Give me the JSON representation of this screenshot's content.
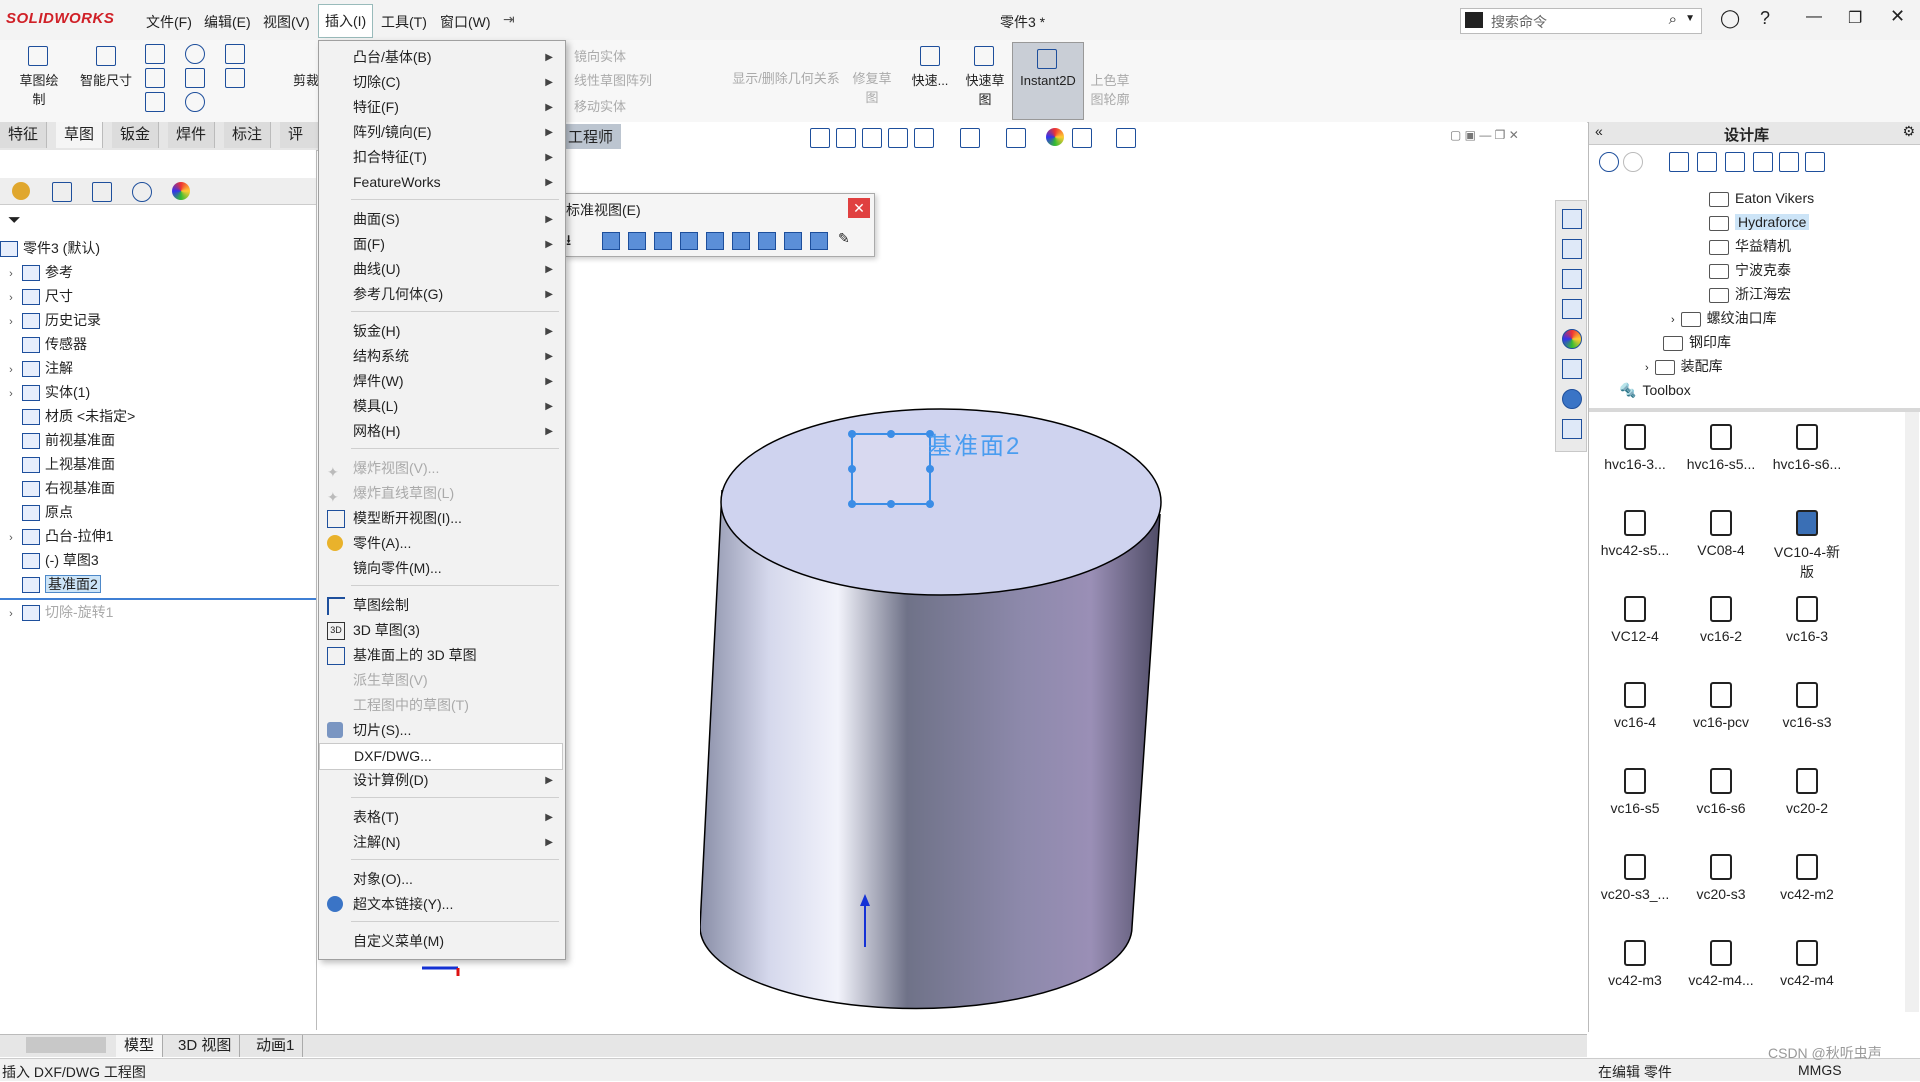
{
  "app": {
    "logo_text": "SOLIDWORKS",
    "doc_title": "零件3 *"
  },
  "menubar": [
    "文件(F)",
    "编辑(E)",
    "视图(V)",
    "插入(I)",
    "工具(T)",
    "窗口(W)"
  ],
  "search": {
    "placeholder": "搜索命令"
  },
  "commands": {
    "sketch": "草图绘制",
    "smart_dim": "智能尺寸",
    "cut": "剪裁",
    "mirror_entity": "镜向实体",
    "linear_pattern": "线性草图阵列",
    "move_entity": "移动实体",
    "show_delete": "显示/删除几何关系",
    "repair": "修复草图",
    "quick_snap": "快速...",
    "rapid_sketch": "快速草图",
    "instant2d": "Instant2D",
    "shaded_contour": "上色草图轮廓"
  },
  "tabs": [
    "特征",
    "草图",
    "钣金",
    "焊件",
    "标注",
    "评估"
  ],
  "partial_tab": "工程师",
  "tree": {
    "root": "零件3 (默认)",
    "items": [
      "参考",
      "尺寸",
      "历史记录",
      "传感器",
      "注解",
      "实体(1)",
      "材质 <未指定>",
      "前视基准面",
      "上视基准面",
      "右视基准面",
      "原点",
      "凸台-拉伸1",
      "(-) 草图3",
      "基准面2",
      "切除-旋转1"
    ]
  },
  "insert_menu": {
    "items": [
      {
        "label": "凸台/基体(B)"
      },
      {
        "label": "切除(C)"
      },
      {
        "label": "特征(F)"
      },
      {
        "label": "阵列/镜向(E)"
      },
      {
        "label": "扣合特征(T)"
      },
      {
        "label": "FeatureWorks"
      },
      {
        "label": "曲面(S)"
      },
      {
        "label": "面(F)"
      },
      {
        "label": "曲线(U)"
      },
      {
        "label": "参考几何体(G)"
      },
      {
        "label": "钣金(H)"
      },
      {
        "label": "结构系统"
      },
      {
        "label": "焊件(W)"
      },
      {
        "label": "模具(L)"
      },
      {
        "label": "网格(H)"
      },
      {
        "label": "爆炸视图(V)..."
      },
      {
        "label": "爆炸直线草图(L)"
      },
      {
        "label": "模型断开视图(I)..."
      },
      {
        "label": "零件(A)..."
      },
      {
        "label": "镜向零件(M)..."
      },
      {
        "label": "草图绘制"
      },
      {
        "label": "3D 草图(3)"
      },
      {
        "label": "基准面上的 3D 草图"
      },
      {
        "label": "派生草图(V)"
      },
      {
        "label": "工程图中的草图(T)"
      },
      {
        "label": "切片(S)..."
      },
      {
        "label": "DXF/DWG..."
      },
      {
        "label": "设计算例(D)"
      },
      {
        "label": "表格(T)"
      },
      {
        "label": "注解(N)"
      },
      {
        "label": "对象(O)..."
      },
      {
        "label": "超文本链接(Y)..."
      },
      {
        "label": "自定义菜单(M)"
      }
    ]
  },
  "std_views": {
    "title": "标准视图(E)"
  },
  "viewport": {
    "plane_label": "基准面2"
  },
  "design_library": {
    "title": "设计库",
    "tree": [
      "Eaton Vikers",
      "Hydraforce",
      "华益精机",
      "宁波克泰",
      "浙江海宏",
      "螺纹油口库",
      "钢印库",
      "装配库",
      "Toolbox"
    ],
    "parts": [
      "hvc16-3...",
      "hvc16-s5...",
      "hvc16-s6...",
      "hvc42-s5...",
      "VC08-4",
      "VC10-4-新版",
      "VC12-4",
      "vc16-2",
      "vc16-3",
      "vc16-4",
      "vc16-pcv",
      "vc16-s3",
      "vc16-s5",
      "vc16-s6",
      "vc20-2",
      "vc20-s3_...",
      "vc20-s3",
      "vc42-m2",
      "vc42-m3",
      "vc42-m4...",
      "vc42-m4"
    ]
  },
  "bottom_tabs": [
    "模型",
    "3D 视图",
    "动画1"
  ],
  "status": {
    "left": "插入 DXF/DWG 工程图",
    "editing": "在编辑 零件",
    "units": "MMGS",
    "watermark": "CSDN @秋听虫声"
  }
}
